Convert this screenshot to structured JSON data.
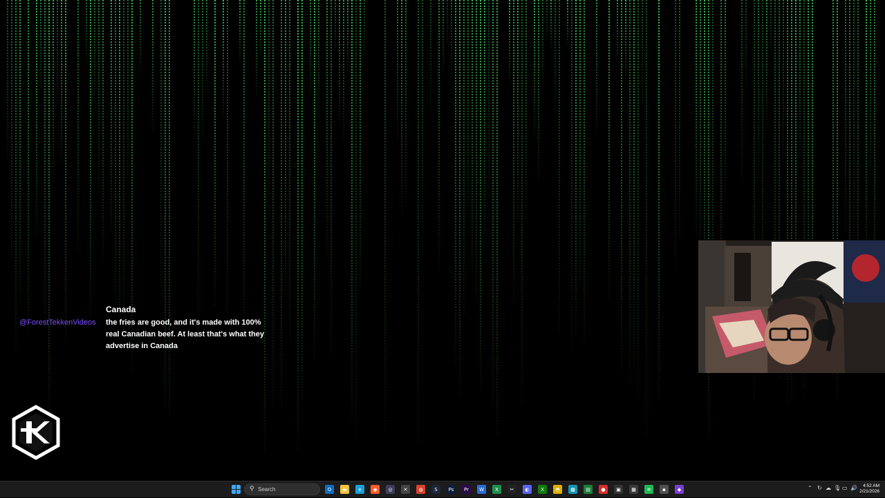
{
  "chat": {
    "title": "Canada",
    "username": "@ForestTekkenVideos",
    "message": "the fries are good, and it's made with 100% real Canadian beef. At least that's what they advertise in Canada"
  },
  "taskbar": {
    "search_placeholder": "Search",
    "pinned_apps": [
      {
        "name": "outlook",
        "color": "#0f6cbd",
        "glyph": "O"
      },
      {
        "name": "file-explorer",
        "color": "#f2c43d",
        "glyph": "▬"
      },
      {
        "name": "edge",
        "color": "#1aa0d8",
        "glyph": "e"
      },
      {
        "name": "firefox",
        "color": "#ff5a2b",
        "glyph": "◉"
      },
      {
        "name": "obs",
        "color": "#3d3d5c",
        "glyph": "◎"
      },
      {
        "name": "app-gray",
        "color": "#444444",
        "glyph": "✕"
      },
      {
        "name": "chrome-canary",
        "color": "#d9432f",
        "glyph": "◍"
      },
      {
        "name": "steam",
        "color": "#1b2838",
        "glyph": "S"
      },
      {
        "name": "photoshop",
        "color": "#0c1e3a",
        "glyph": "Ps"
      },
      {
        "name": "premiere",
        "color": "#2a0a4a",
        "glyph": "Pr"
      },
      {
        "name": "word",
        "color": "#2b6cd3",
        "glyph": "W"
      },
      {
        "name": "excel",
        "color": "#1e8f4e",
        "glyph": "X"
      },
      {
        "name": "capcut",
        "color": "#222222",
        "glyph": "✂"
      },
      {
        "name": "discord",
        "color": "#5865f2",
        "glyph": "◐"
      },
      {
        "name": "xbox",
        "color": "#107c10",
        "glyph": "X"
      },
      {
        "name": "chrome",
        "color": "#e0b100",
        "glyph": "◓"
      },
      {
        "name": "app-teal",
        "color": "#1296b0",
        "glyph": "▦"
      },
      {
        "name": "app-green",
        "color": "#1b7f3a",
        "glyph": "▤"
      },
      {
        "name": "app-red",
        "color": "#d92d2d",
        "glyph": "●"
      },
      {
        "name": "app-dark",
        "color": "#333333",
        "glyph": "▣"
      },
      {
        "name": "calculator",
        "color": "#3a3a3a",
        "glyph": "▦"
      },
      {
        "name": "spotify",
        "color": "#1db954",
        "glyph": "≋"
      },
      {
        "name": "app-gray-2",
        "color": "#505050",
        "glyph": "▪"
      },
      {
        "name": "app-purple",
        "color": "#7a3fd0",
        "glyph": "◆"
      }
    ],
    "clock_time": "4:52 AM",
    "clock_date": "2/21/2026"
  },
  "colors": {
    "rain_green": "#3fd35a",
    "username": "#7b4dff",
    "taskbar_bg": "#1c1c1c"
  }
}
